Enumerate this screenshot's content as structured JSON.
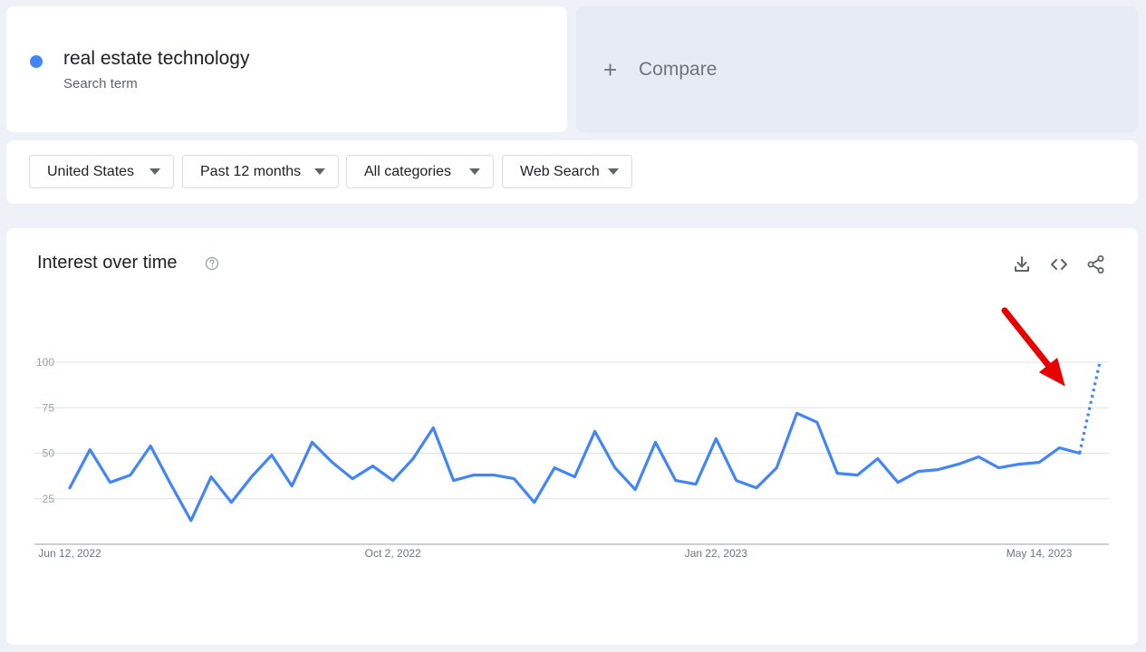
{
  "search": {
    "term": "real estate technology",
    "subtitle": "Search term",
    "dot_color": "#4285f4"
  },
  "compare": {
    "label": "Compare",
    "icon": "plus-icon"
  },
  "filters": [
    {
      "label": "United States"
    },
    {
      "label": "Past 12 months"
    },
    {
      "label": "All categories"
    },
    {
      "label": "Web Search"
    }
  ],
  "panel": {
    "title": "Interest over time",
    "help_icon": "help-circle-icon",
    "actions": [
      "download-icon",
      "embed-code-icon",
      "share-icon"
    ]
  },
  "chart_data": {
    "type": "line",
    "ylim": [
      0,
      100
    ],
    "y_ticks": [
      25,
      50,
      75,
      100
    ],
    "x_tick_labels": [
      {
        "index": 0,
        "label": "Jun 12, 2022"
      },
      {
        "index": 16,
        "label": "Oct 2, 2022"
      },
      {
        "index": 32,
        "label": "Jan 22, 2023"
      },
      {
        "index": 48,
        "label": "May 14, 2023"
      }
    ],
    "grid": true,
    "series": [
      {
        "color": "#4285f4",
        "values": [
          31,
          52,
          34,
          38,
          54,
          33,
          13,
          37,
          23,
          37,
          49,
          32,
          56,
          45,
          36,
          43,
          35,
          47,
          64,
          35,
          38,
          38,
          36,
          23,
          42,
          37,
          62,
          42,
          30,
          56,
          35,
          33,
          58,
          35,
          31,
          42,
          72,
          67,
          39,
          38,
          47,
          34,
          40,
          41,
          44,
          48,
          42,
          44,
          45,
          53,
          50,
          100
        ],
        "partial_from_index": 50
      }
    ],
    "annotation": {
      "type": "arrow",
      "color": "#e60000",
      "points_to_index": 50
    }
  }
}
